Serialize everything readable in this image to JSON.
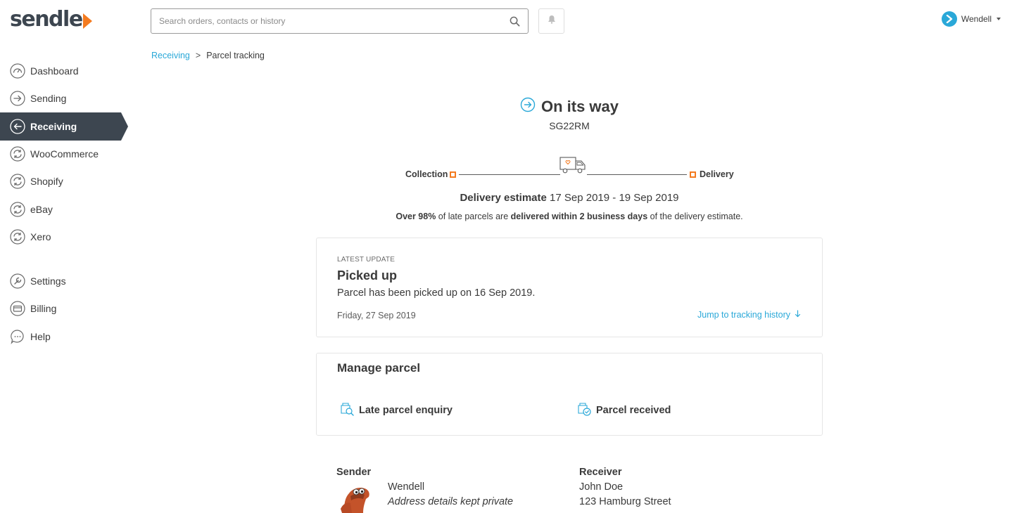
{
  "brand": {
    "logo_text": "sendle",
    "accent": "#f47b20",
    "link_color": "#2aa8d8",
    "sidebar_active_bg": "#3d4650"
  },
  "header": {
    "search_placeholder": "Search orders, contacts or history",
    "search_icon": "search-icon",
    "bell_icon": "bell-icon",
    "user_name": "Wendell"
  },
  "sidebar": {
    "items": [
      {
        "label": "Dashboard",
        "icon": "dashboard-icon"
      },
      {
        "label": "Sending",
        "icon": "arrow-right-circle-icon"
      },
      {
        "label": "Receiving",
        "icon": "arrow-left-circle-icon",
        "active": true
      },
      {
        "label": "WooCommerce",
        "icon": "sync-icon"
      },
      {
        "label": "Shopify",
        "icon": "sync-icon"
      },
      {
        "label": "eBay",
        "icon": "sync-icon"
      },
      {
        "label": "Xero",
        "icon": "sync-icon"
      },
      {
        "label": "Settings",
        "icon": "wrench-icon"
      },
      {
        "label": "Billing",
        "icon": "card-icon"
      },
      {
        "label": "Help",
        "icon": "chat-icon"
      }
    ]
  },
  "breadcrumb": {
    "parent": "Receiving",
    "separator": ">",
    "current": "Parcel tracking"
  },
  "status": {
    "title": "On its way",
    "tracking_number": "SG22RM"
  },
  "progress": {
    "start_label": "Collection",
    "end_label": "Delivery"
  },
  "estimate": {
    "label": "Delivery estimate",
    "range": "17 Sep 2019 - 19 Sep 2019",
    "note_a": "Over 98%",
    "note_b": " of late parcels are ",
    "note_c": "delivered within 2 business days",
    "note_d": " of the delivery estimate."
  },
  "latest_update": {
    "eyebrow": "LATEST UPDATE",
    "title": "Picked up",
    "description": "Parcel has been picked up on 16 Sep 2019.",
    "date": "Friday, 27 Sep 2019",
    "jump_link": "Jump to tracking history"
  },
  "manage": {
    "title": "Manage parcel",
    "late_enquiry": "Late parcel enquiry",
    "received": "Parcel received"
  },
  "sender": {
    "label": "Sender",
    "name": "Wendell",
    "address": "Address details kept private"
  },
  "receiver": {
    "label": "Receiver",
    "name": "John Doe",
    "address": "123 Hamburg Street"
  }
}
